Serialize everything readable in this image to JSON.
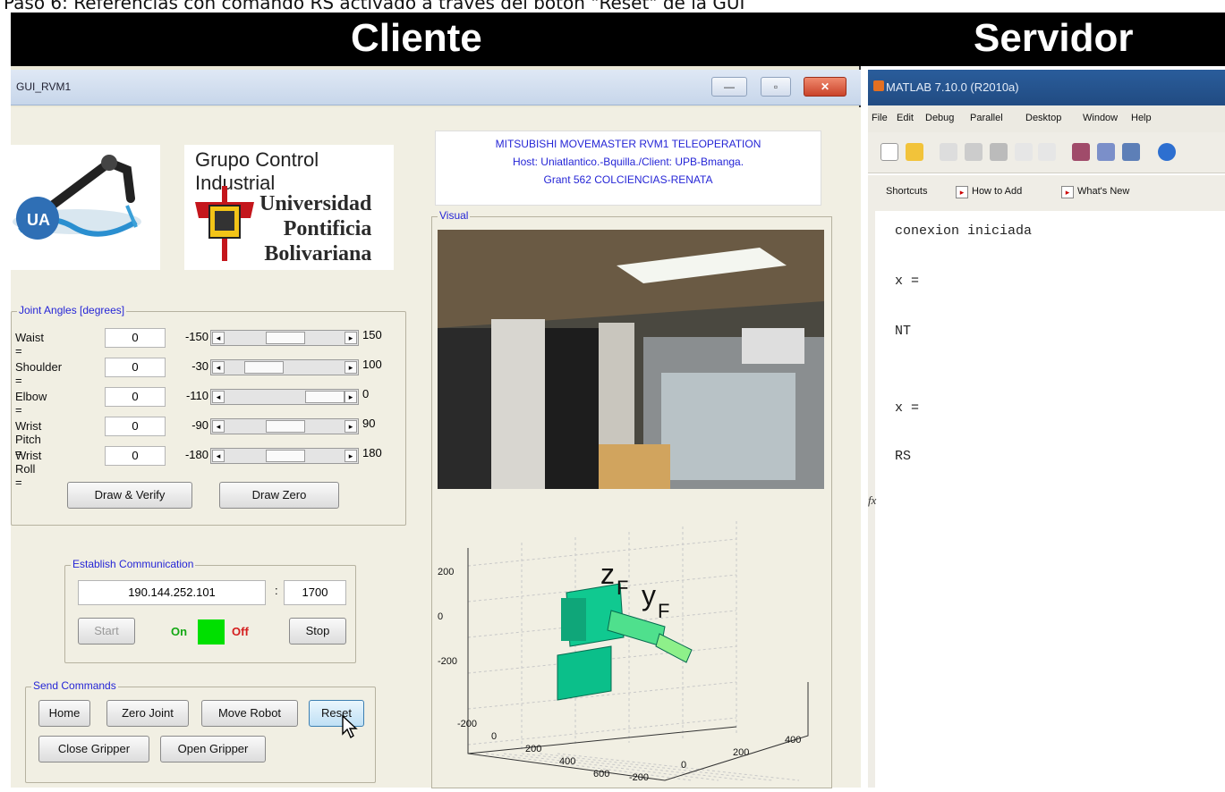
{
  "caption": "Paso 6: Referencias con comando RS activado a través del botón \"Reset\" de la GUI",
  "headers": {
    "left": "Cliente",
    "right": "Servidor"
  },
  "client": {
    "window_title": "GUI_RVM1",
    "window_buttons": {
      "minimize": "—",
      "maximize": "▫",
      "close": "✕"
    },
    "logo_group_title": "Grupo Control Industrial",
    "logo_univ": [
      "Universidad",
      "Pontificia",
      "Bolivariana"
    ],
    "info_lines": [
      "MITSUBISHI MOVEMASTER RVM1 TELEOPERATION",
      "Host: Uniatlantico.-Bquilla./Client: UPB-Bmanga.",
      "Grant 562 COLCIENCIAS-RENATA"
    ],
    "joint_panel": {
      "legend": "Joint Angles [degrees]",
      "rows": [
        {
          "label": "Waist =",
          "value": "0",
          "min": "-150",
          "max": "150",
          "level": 0.5
        },
        {
          "label": "Shoulder =",
          "value": "0",
          "min": "-30",
          "max": "100",
          "level": 0.23
        },
        {
          "label": "Elbow =",
          "value": "0",
          "min": "-110",
          "max": "0",
          "level": 1.0
        },
        {
          "label": "Wrist Pitch =",
          "value": "0",
          "min": "-90",
          "max": "90",
          "level": 0.5
        },
        {
          "label": "Wrist Roll =",
          "value": "0",
          "min": "-180",
          "max": "180",
          "level": 0.5
        }
      ],
      "draw_verify": "Draw & Verify",
      "draw_zero": "Draw Zero"
    },
    "comm_panel": {
      "legend": "Establish Communication",
      "ip": "190.144.252.101",
      "sep": ":",
      "port": "1700",
      "start": "Start",
      "on": "On",
      "off": "Off",
      "stop": "Stop"
    },
    "send_panel": {
      "legend": "Send Commands",
      "home": "Home",
      "zero_joint": "Zero Joint",
      "move_robot": "Move Robot",
      "reset": "Reset",
      "close_gripper": "Close Gripper",
      "open_gripper": "Open Gripper"
    },
    "visual_panel": {
      "legend": "Visual",
      "plot": {
        "z_ticks": [
          "200",
          "0",
          "-200"
        ],
        "x_ticks": [
          "-200",
          "0",
          "200",
          "400",
          "600"
        ],
        "y_ticks": [
          "400",
          "200",
          "0",
          "-200"
        ],
        "z_label_main": "z",
        "z_label_sub": "F",
        "y_label_main": "y",
        "y_label_sub": "F"
      }
    }
  },
  "server": {
    "window_title": "MATLAB 7.10.0 (R2010a)",
    "menu": [
      "File",
      "Edit",
      "Debug",
      "Parallel",
      "Desktop",
      "Window",
      "Help"
    ],
    "shortcuts": [
      "Shortcuts",
      "How to Add",
      "What's New"
    ],
    "command_lines": [
      "conexion iniciada",
      "x =",
      "NT",
      "x =",
      "RS"
    ],
    "fx": "fx"
  },
  "colors": {
    "led_on": "#00e000",
    "legend_text": "#2525d6",
    "on_text": "#14a814",
    "off_text": "#d41e1e"
  }
}
